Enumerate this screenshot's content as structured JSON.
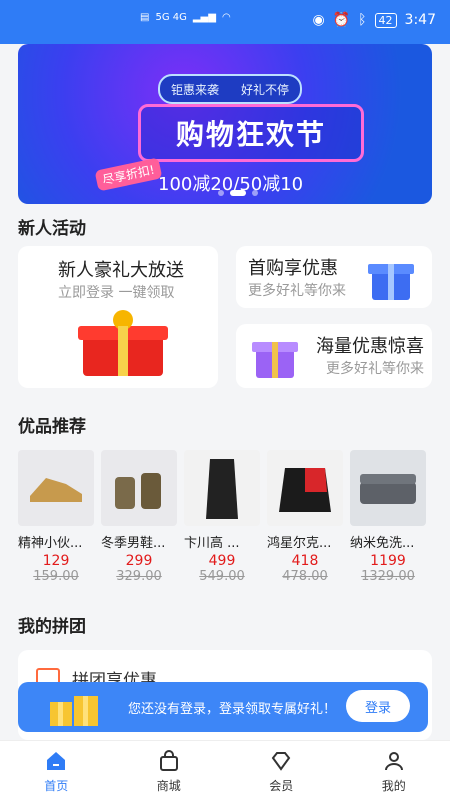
{
  "status_bar": {
    "signal_left": "HD 1\nHD 2",
    "network": "5G 4G",
    "battery": "42",
    "time": "3:47"
  },
  "banner": {
    "tag_left": "钜惠来袭",
    "tag_right": "好礼不停",
    "title": "购物狂欢节",
    "side": "尽享折扣!",
    "subtitle": "100减20/50减10"
  },
  "sections": {
    "new_user": "新人活动",
    "recommend": "优品推荐",
    "group": "我的拼团"
  },
  "new_user": {
    "gift_title": "新人豪礼大放送",
    "gift_sub": "立即登录 一键领取",
    "first_title": "首购享优惠",
    "first_sub": "更多好礼等你来",
    "mass_title": "海量优惠惊喜",
    "mass_sub": "更多好礼等你来"
  },
  "products": [
    {
      "name": "精神小伙...",
      "price": "129",
      "old": "159.00"
    },
    {
      "name": "冬季男鞋...",
      "price": "299",
      "old": "329.00"
    },
    {
      "name": "卞川高 ...",
      "price": "499",
      "old": "549.00"
    },
    {
      "name": "鸿星尔克...",
      "price": "418",
      "old": "478.00"
    },
    {
      "name": "纳米免洗...",
      "price": "1199",
      "old": "1329.00"
    }
  ],
  "group": {
    "title": "拼团享优惠"
  },
  "login_bar": {
    "message": "您还没有登录，登录领取专属好礼！",
    "button": "登录"
  },
  "tabs": [
    {
      "label": "首页"
    },
    {
      "label": "商城"
    },
    {
      "label": "会员"
    },
    {
      "label": "我的"
    }
  ],
  "colors": {
    "accent": "#2f7cf6",
    "price": "#e21b1b"
  }
}
